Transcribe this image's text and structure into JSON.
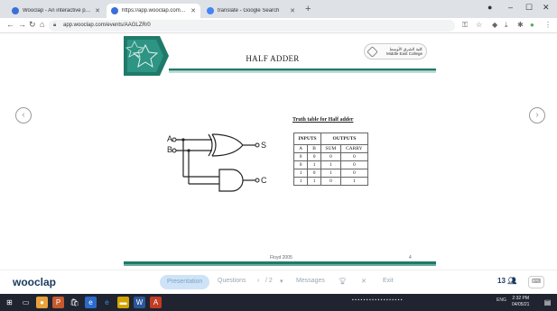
{
  "browser": {
    "tabs": [
      {
        "title": "Wooclap - An interactive platfo",
        "active": false,
        "favicon_color": "#3b6fd8"
      },
      {
        "title": "https://app.wooclap.com/event",
        "active": true,
        "favicon_color": "#3b6fd8"
      },
      {
        "title": "translate - Google Search",
        "active": false,
        "favicon_color": "#4285f4"
      }
    ],
    "url": "app.wooclap.com/events/AAGLZR/0"
  },
  "slide": {
    "title": "HALF ADDER",
    "logo_arabic": "كلية الشرق الأوسط",
    "logo_english": "Middle East College",
    "truth_table_title": "Truth table for Half adder",
    "table": {
      "group_headers": [
        "INPUTS",
        "OUTPUTS"
      ],
      "columns": [
        "A",
        "B",
        "SUM",
        "CARRY"
      ],
      "rows": [
        [
          "0",
          "0",
          "0",
          "0"
        ],
        [
          "0",
          "1",
          "1",
          "0"
        ],
        [
          "1",
          "0",
          "1",
          "0"
        ],
        [
          "1",
          "1",
          "0",
          "1"
        ]
      ]
    },
    "circuit": {
      "input_a": "A",
      "input_b": "B",
      "output_s": "S",
      "output_c": "C"
    },
    "footer": "Floyd 2005",
    "page_number": "4"
  },
  "wooclap": {
    "logo": "wooclap",
    "presentation": "Presentation",
    "questions": "Questions",
    "pager": "/ 2",
    "messages": "Messages",
    "exit": "Exit",
    "participants": "13"
  },
  "taskbar": {
    "language": "ENG",
    "time": "2:32 PM",
    "date": "04/05/21"
  },
  "colors": {
    "accent_green": "#1f7a6a",
    "wooclap_navy": "#1a3a5c",
    "taskbar": "#1f2430"
  }
}
